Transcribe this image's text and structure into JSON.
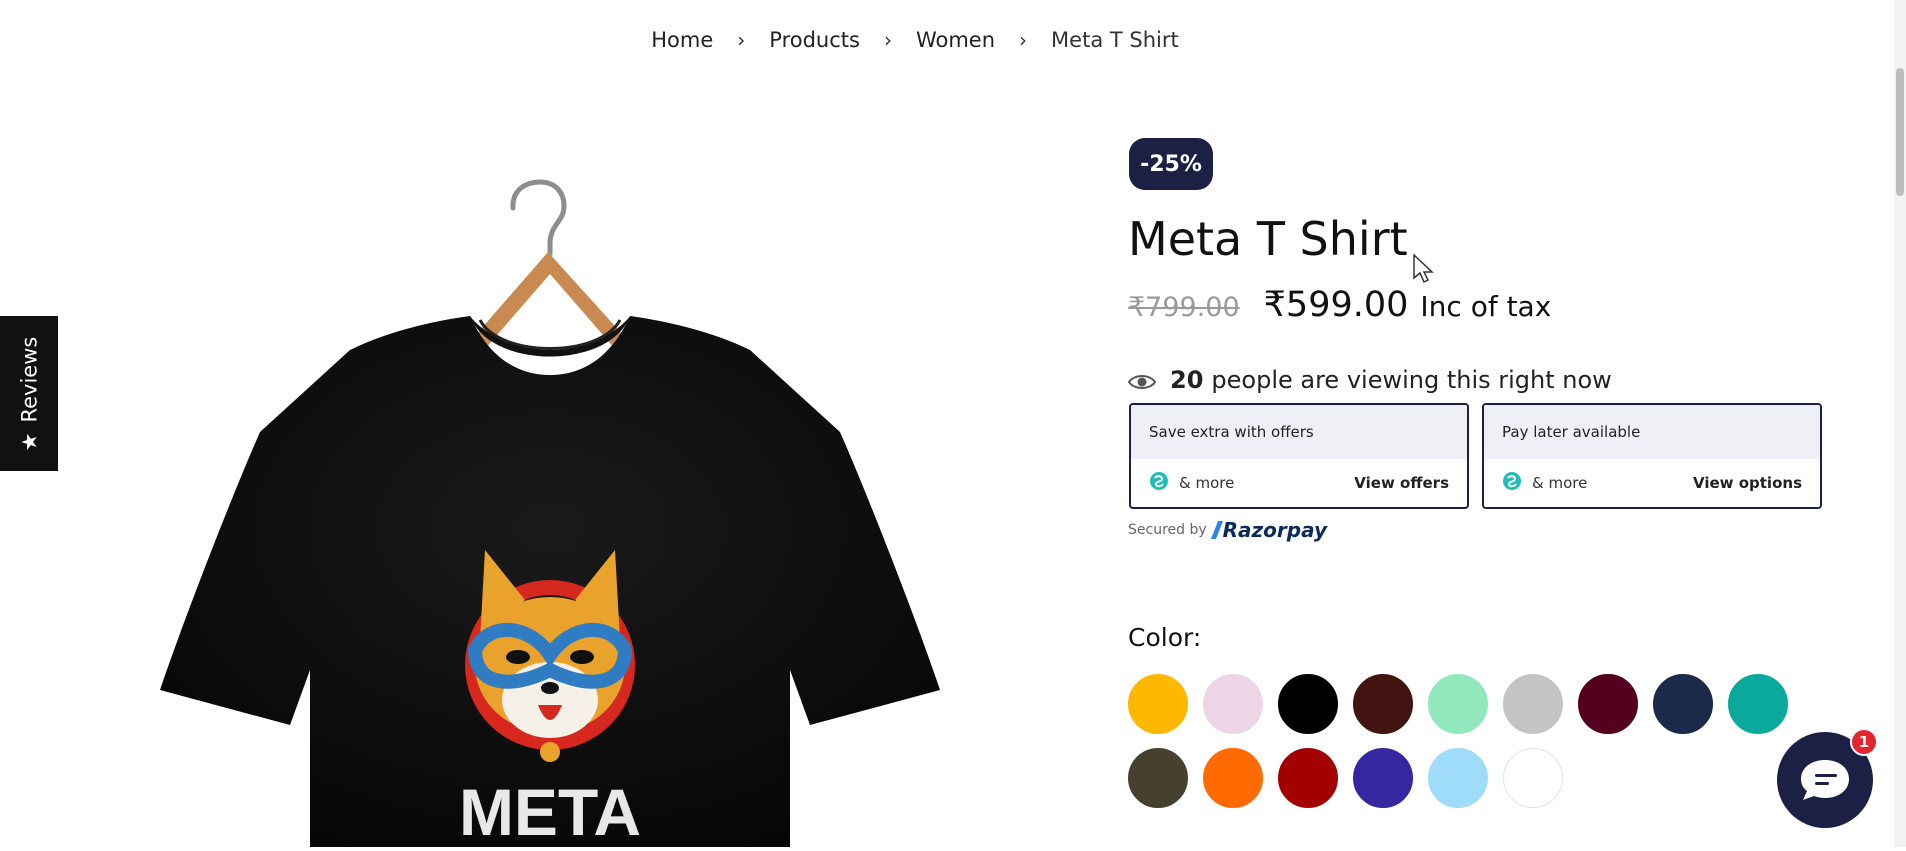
{
  "breadcrumb": {
    "items": [
      "Home",
      "Products",
      "Women",
      "Meta T Shirt"
    ],
    "separator": "›"
  },
  "reviews_tab": {
    "label": "Reviews",
    "icon": "star-icon"
  },
  "product": {
    "discount": "-25%",
    "title": "Meta T Shirt",
    "price_old": "₹799.00",
    "price_new": "₹599.00",
    "price_note": "Inc of tax",
    "image_text": "META"
  },
  "viewers": {
    "count": "20",
    "text": "people are viewing this right now",
    "icon": "eye-icon"
  },
  "offers": [
    {
      "title": "Save extra with offers",
      "sub": "& more",
      "link": "View offers"
    },
    {
      "title": "Pay later available",
      "sub": "& more",
      "link": "View options"
    }
  ],
  "secured": {
    "prefix": "Secured by",
    "brand": "Razorpay"
  },
  "color": {
    "label": "Color:",
    "swatches": [
      "#FFB800",
      "#EBD5E6",
      "#000000",
      "#421512",
      "#92E8BD",
      "#C4C4C4",
      "#560020",
      "#1B2A48",
      "#0AA99B",
      "#46402F",
      "#FF6B00",
      "#A30000",
      "#36269F",
      "#9EDCFA",
      "#FFFFFF"
    ]
  },
  "chat": {
    "badge": "1",
    "icon": "chat-bubble-icon"
  },
  "colors": {
    "accent": "#1B2044",
    "badge_red": "#E3262D"
  }
}
